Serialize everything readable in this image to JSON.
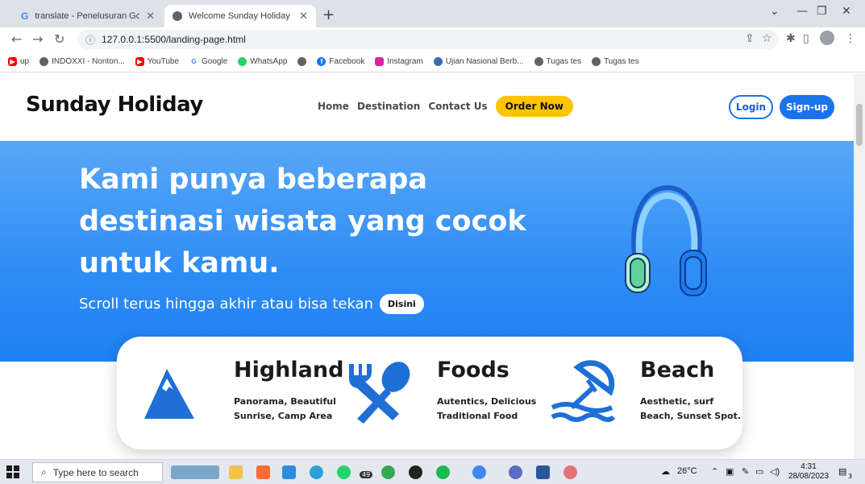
{
  "browser": {
    "tabs": [
      {
        "title": "translate - Penelusuran Google",
        "icon": "google-icon"
      },
      {
        "title": "Welcome Sunday Holiday",
        "icon": "globe-icon"
      }
    ],
    "url": "127.0.0.1:5500/landing-page.html",
    "bookmarks": [
      {
        "label": "up",
        "icon": "youtube-icon"
      },
      {
        "label": "INDOXXI - Nonton...",
        "icon": "globe-icon"
      },
      {
        "label": "YouTube",
        "icon": "youtube-icon"
      },
      {
        "label": "Google",
        "icon": "google-icon"
      },
      {
        "label": "WhatsApp",
        "icon": "whatsapp-icon"
      },
      {
        "label": "",
        "icon": "globe-icon"
      },
      {
        "label": "Facebook",
        "icon": "facebook-icon"
      },
      {
        "label": "Instagram",
        "icon": "instagram-icon"
      },
      {
        "label": "Ujian Nasional Berb...",
        "icon": "globe-icon"
      },
      {
        "label": "Tugas tes",
        "icon": "globe-icon"
      },
      {
        "label": "Tugas tes",
        "icon": "globe-icon"
      }
    ]
  },
  "site": {
    "logo": "Sunday Holiday",
    "nav": [
      "Home",
      "Destination",
      "Contact Us"
    ],
    "order_label": "Order Now",
    "login_label": "Login",
    "signup_label": "Sign-up"
  },
  "hero": {
    "title_lines": [
      "Kami punya beberapa",
      "destinasi wisata yang cocok",
      "untuk kamu."
    ],
    "subtitle": "Scroll terus hingga akhir atau bisa tekan",
    "button_label": "Disini"
  },
  "features": [
    {
      "title": "Highland",
      "desc_lines": [
        "Panorama, Beautiful",
        "Sunrise, Camp Area"
      ],
      "icon": "mountain-icon"
    },
    {
      "title": "Foods",
      "desc_lines": [
        "Autentics, Delicious",
        "Traditional Food"
      ],
      "icon": "fork-spoon-icon"
    },
    {
      "title": "Beach",
      "desc_lines": [
        "Aesthetic, surf",
        "Beach, Sunset Spot."
      ],
      "icon": "beach-umbrella-icon"
    }
  ],
  "taskbar": {
    "search_placeholder": "Type here to search",
    "badge_count": "49",
    "temperature": "26°C",
    "time": "4:31",
    "date": "28/08/2023",
    "notification_count": "3"
  },
  "colors": {
    "brand_blue": "#1a73e8",
    "order_yellow": "#ffc400",
    "icon_blue": "#1f6fd6"
  }
}
